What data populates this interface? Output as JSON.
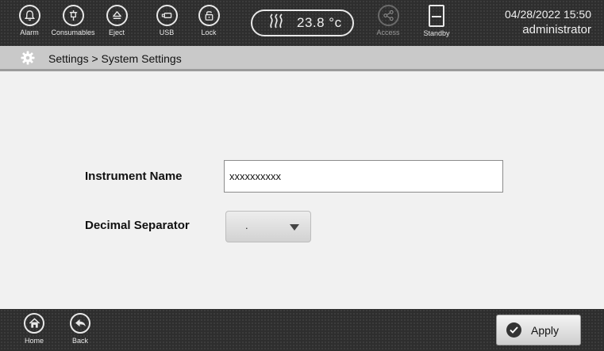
{
  "topbar": {
    "alarm_label": "Alarm",
    "consumables_label": "Consumables",
    "eject_label": "Eject",
    "usb_label": "USB",
    "lock_label": "Lock",
    "temperature": "23.8 °c",
    "access_label": "Access",
    "standby_label": "Standby",
    "datetime": "04/28/2022 15:50",
    "user": "administrator"
  },
  "breadcrumb": {
    "icon": "gear-icon",
    "text": "Settings > System Settings"
  },
  "form": {
    "instrument_name_label": "Instrument Name",
    "instrument_name_value": "xxxxxxxxxx",
    "decimal_separator_label": "Decimal Separator",
    "decimal_separator_value": "."
  },
  "bottombar": {
    "home_label": "Home",
    "back_label": "Back",
    "apply_label": "Apply"
  },
  "colors": {
    "bar_background": "#2e2e2e",
    "breadcrumb_background": "#c9c9c9",
    "content_background": "#f1f1f1",
    "icon_color": "#e8e8e8"
  }
}
